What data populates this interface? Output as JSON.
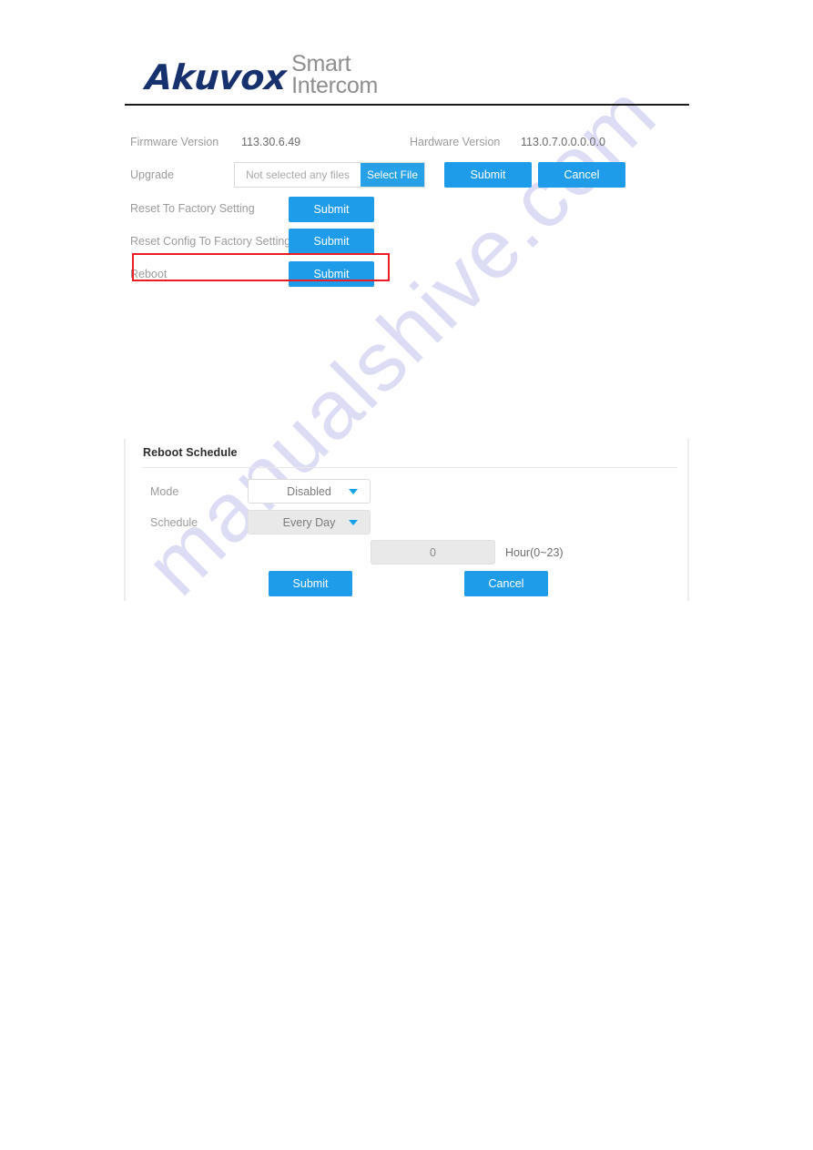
{
  "logo": {
    "brand": "Akuvox",
    "tagline_line1": "Smart",
    "tagline_line2": "Intercom",
    "brand_color": "#17306e",
    "tagline_color": "#8e8e8e"
  },
  "watermark": {
    "text": "manualshive.com",
    "color": "#c9c7ef"
  },
  "upgrade": {
    "firmware_label": "Firmware Version",
    "firmware_value": "113.30.6.49",
    "hardware_label": "Hardware Version",
    "hardware_value": "113.0.7.0.0.0.0.0",
    "upgrade_label": "Upgrade",
    "file_placeholder": "Not selected any files",
    "select_file_label": "Select File",
    "submit_label": "Submit",
    "cancel_label": "Cancel",
    "reset_factory_label": "Reset To Factory Setting",
    "reset_factory_submit": "Submit",
    "reset_config_label": "Reset Config To Factory Setting",
    "reset_config_submit": "Submit",
    "reboot_label": "Reboot",
    "reboot_submit": "Submit",
    "highlight_color": "#ee1c25"
  },
  "reboot_schedule": {
    "title": "Reboot Schedule",
    "mode_label": "Mode",
    "mode_value": "Disabled",
    "schedule_label": "Schedule",
    "schedule_value": "Every Day",
    "hour_value": "0",
    "hour_hint": "Hour(0~23)",
    "submit_label": "Submit",
    "cancel_label": "Cancel",
    "accent_color": "#1e9cea"
  }
}
